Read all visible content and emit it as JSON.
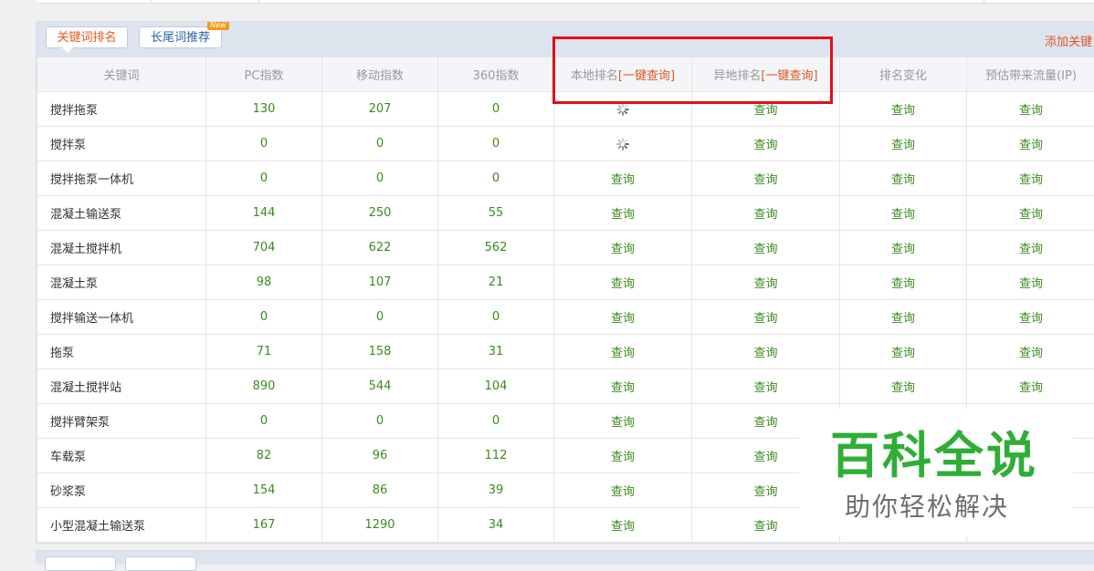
{
  "tabs": {
    "active_label": "关键词排名",
    "second_label": "长尾词推荐",
    "new_badge": "New",
    "add_link": "添加关键"
  },
  "columns": [
    "关键词",
    "PC指数",
    "移动指数",
    "360指数",
    "本地排名",
    "[一键查询]",
    "异地排名",
    "[一键查询]",
    "排名变化",
    "预估带来流量(IP)"
  ],
  "query_label": "查询",
  "rows": [
    {
      "kw": "搅拌拖泵",
      "pc": "130",
      "mobile": "207",
      "s360": "0",
      "local": "loading",
      "remote": "查询",
      "change": "查询",
      "traffic": "查询"
    },
    {
      "kw": "搅拌泵",
      "pc": "0",
      "mobile": "0",
      "s360": "0",
      "local": "loading",
      "remote": "查询",
      "change": "查询",
      "traffic": "查询"
    },
    {
      "kw": "搅拌拖泵一体机",
      "pc": "0",
      "mobile": "0",
      "s360": "0",
      "local": "查询",
      "remote": "查询",
      "change": "查询",
      "traffic": "查询"
    },
    {
      "kw": "混凝土输送泵",
      "pc": "144",
      "mobile": "250",
      "s360": "55",
      "local": "查询",
      "remote": "查询",
      "change": "查询",
      "traffic": "查询"
    },
    {
      "kw": "混凝土搅拌机",
      "pc": "704",
      "mobile": "622",
      "s360": "562",
      "local": "查询",
      "remote": "查询",
      "change": "查询",
      "traffic": "查询"
    },
    {
      "kw": "混凝土泵",
      "pc": "98",
      "mobile": "107",
      "s360": "21",
      "local": "查询",
      "remote": "查询",
      "change": "查询",
      "traffic": "查询"
    },
    {
      "kw": "搅拌输送一体机",
      "pc": "0",
      "mobile": "0",
      "s360": "0",
      "local": "查询",
      "remote": "查询",
      "change": "查询",
      "traffic": "查询"
    },
    {
      "kw": "拖泵",
      "pc": "71",
      "mobile": "158",
      "s360": "31",
      "local": "查询",
      "remote": "查询",
      "change": "查询",
      "traffic": "查询"
    },
    {
      "kw": "混凝土搅拌站",
      "pc": "890",
      "mobile": "544",
      "s360": "104",
      "local": "查询",
      "remote": "查询",
      "change": "查询",
      "traffic": "查询"
    },
    {
      "kw": "搅拌臂架泵",
      "pc": "0",
      "mobile": "0",
      "s360": "0",
      "local": "查询",
      "remote": "查询",
      "change": "",
      "traffic": ""
    },
    {
      "kw": "车载泵",
      "pc": "82",
      "mobile": "96",
      "s360": "112",
      "local": "查询",
      "remote": "查询",
      "change": "",
      "traffic": ""
    },
    {
      "kw": "砂浆泵",
      "pc": "154",
      "mobile": "86",
      "s360": "39",
      "local": "查询",
      "remote": "查询",
      "change": "",
      "traffic": ""
    },
    {
      "kw": "小型混凝土输送泵",
      "pc": "167",
      "mobile": "1290",
      "s360": "34",
      "local": "查询",
      "remote": "查询",
      "change": "",
      "traffic": ""
    }
  ],
  "watermark": {
    "title": "百科全说",
    "subtitle": "助你轻松解决"
  },
  "colors": {
    "accent": "#e0581b",
    "value_green": "#3a8a1e",
    "highlight_box": "#e0101a",
    "header_bg": "#dde4ee",
    "watermark_green": "#2fae36"
  }
}
